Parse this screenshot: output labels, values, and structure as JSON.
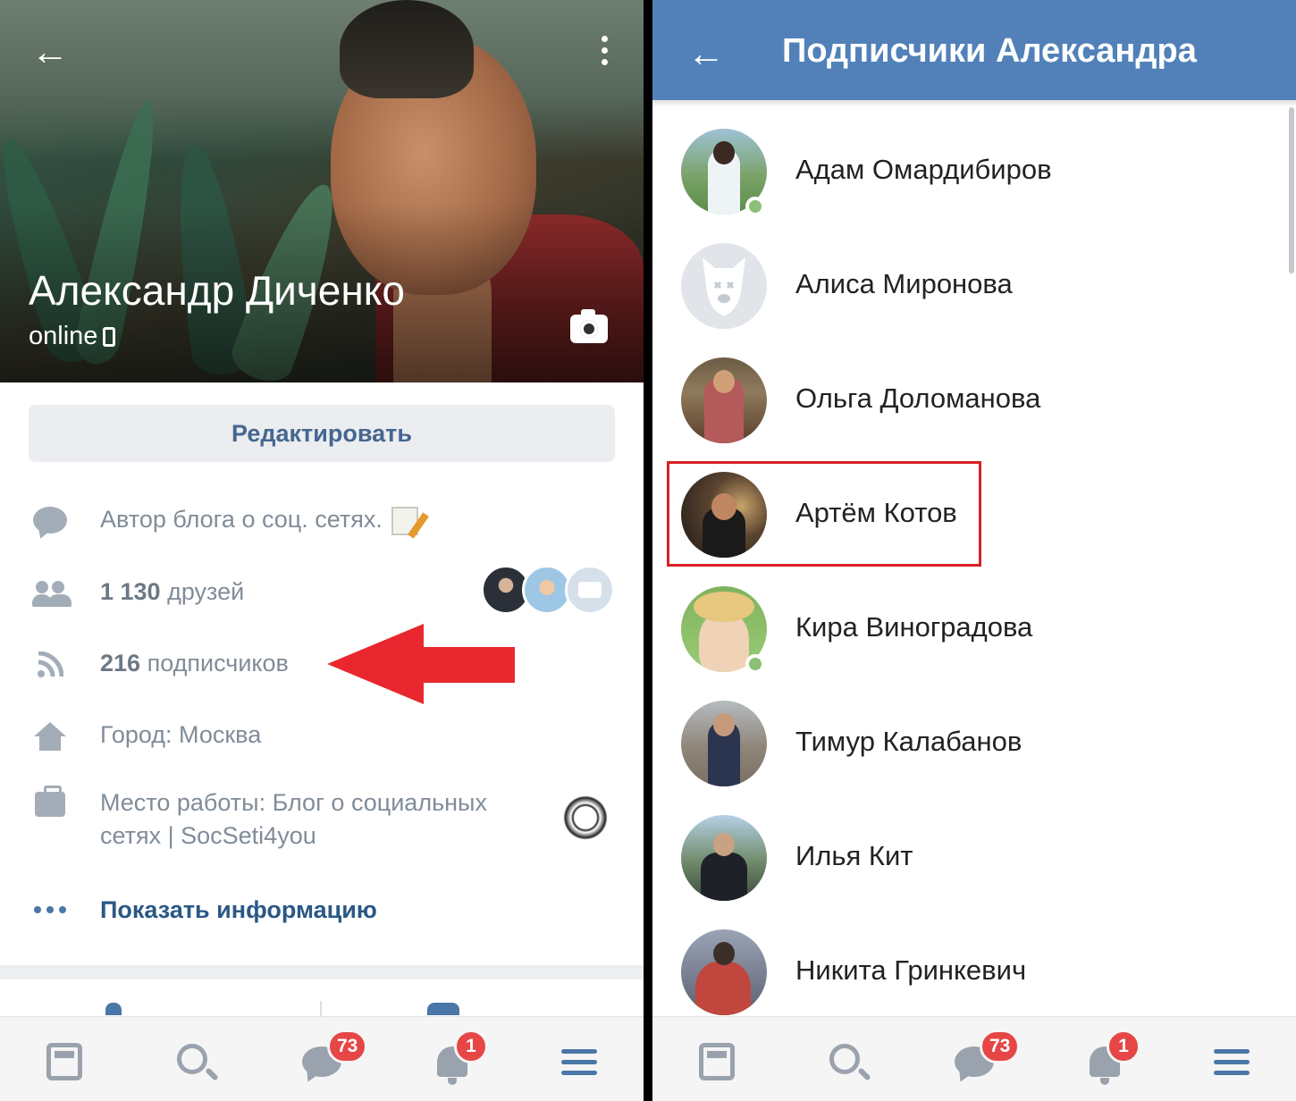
{
  "profile": {
    "name": "Александр Диченко",
    "status": "online",
    "edit_label": "Редактировать",
    "about": "Автор блога о соц. сетях.",
    "friends_count": "1 130",
    "friends_label": "друзей",
    "followers_count": "216",
    "followers_label": "подписчиков",
    "city": "Город: Москва",
    "work_line1": "Место работы: Блог о социальных",
    "work_line2": "сетях | SocSeti4you",
    "show_info": "Показать информацию",
    "icons": [
      "back-arrow-icon",
      "more-vertical-icon",
      "camera-icon",
      "chat-bubble-icon",
      "friends-icon",
      "rss-icon",
      "home-icon",
      "briefcase-icon",
      "dots-icon"
    ]
  },
  "bottom_nav": {
    "items": [
      "news-icon",
      "search-icon",
      "messages-icon",
      "notifications-icon",
      "menu-icon"
    ],
    "messages_badge": "73",
    "notifications_badge": "1"
  },
  "subscribers": {
    "title": "Подписчики Александра",
    "items": [
      {
        "name": "Адам Омардибиров",
        "online": true
      },
      {
        "name": "Алиса Миронова",
        "online": false
      },
      {
        "name": "Ольга Доломанова",
        "online": false
      },
      {
        "name": "Артём Котов",
        "online": false,
        "highlighted": true
      },
      {
        "name": "Кира Виноградова",
        "online": true
      },
      {
        "name": "Тимур Калабанов",
        "online": false
      },
      {
        "name": "Илья Кит",
        "online": false
      },
      {
        "name": "Никита Гринкевич",
        "online": false
      }
    ]
  },
  "colors": {
    "header_blue": "#5181b8",
    "link_blue": "#2a5885",
    "badge_red": "#e64646",
    "annotation_red": "#e8282e",
    "online_green": "#8ac176"
  }
}
